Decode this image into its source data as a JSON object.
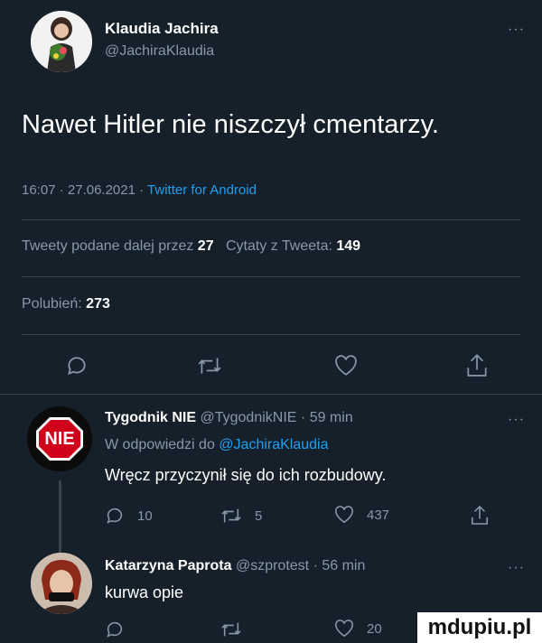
{
  "main_tweet": {
    "author_name": "Klaudia Jachira",
    "author_handle": "@JachiraKlaudia",
    "text": "Nawet Hitler nie niszczył cmentarzy.",
    "time": "16:07",
    "date": "27.06.2021",
    "sep": "·",
    "source": "Twitter for Android",
    "retweets_label": "Tweety podane dalej przez",
    "retweets_count": "27",
    "quotes_label": "Cytaty z Tweeta:",
    "quotes_count": "149",
    "likes_label": "Polubień:",
    "likes_count": "273"
  },
  "replies": [
    {
      "author_name": "Tygodnik NIE",
      "author_handle": "@TygodnikNIE",
      "time": "59 min",
      "sep": "·",
      "reply_to_label": "W odpowiedzi do",
      "reply_to_handle": "@JachiraKlaudia",
      "text": "Wręcz przyczynił się do ich rozbudowy.",
      "avatar_text": "NIE",
      "reply_count": "10",
      "retweet_count": "5",
      "like_count": "437"
    },
    {
      "author_name": "Katarzyna Paprota",
      "author_handle": "@szprotest",
      "time": "56 min",
      "sep": "·",
      "text": "kurwa opie",
      "like_count": "20"
    }
  ],
  "more_label": "···",
  "watermark": "mdupiu.pl",
  "colors": {
    "background": "#15202b",
    "accent": "#1da1f2",
    "muted": "#8899a6",
    "divider": "#38444d",
    "nie_red": "#d0021b"
  },
  "icons": [
    "reply-icon",
    "retweet-icon",
    "like-icon",
    "share-icon"
  ]
}
